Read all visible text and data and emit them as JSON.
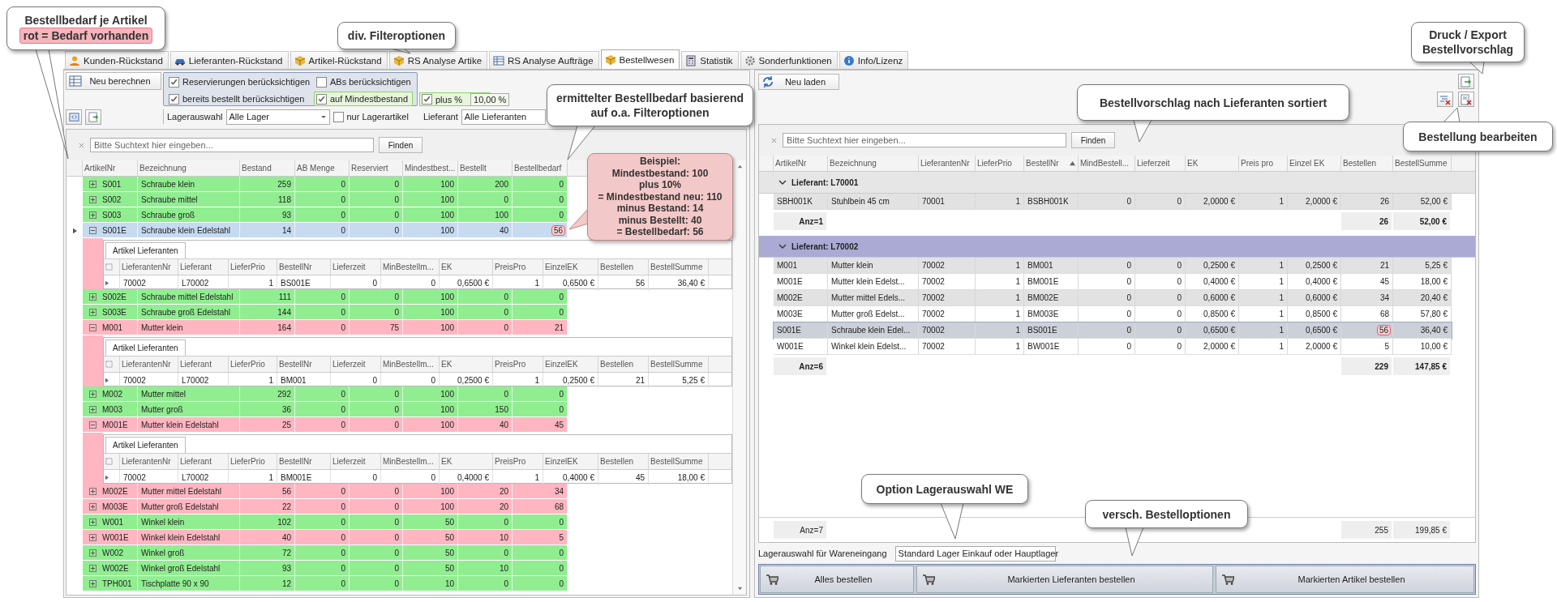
{
  "tabs": [
    {
      "label": "Kunden-Rückstand",
      "selected": false
    },
    {
      "label": "Lieferanten-Rückstand",
      "selected": false
    },
    {
      "label": "Artikel-Rückstand",
      "selected": false
    },
    {
      "label": "RS Analyse Artike",
      "selected": false
    },
    {
      "label": "RS Analyse Aufträge",
      "selected": false
    },
    {
      "label": "Bestellwesen",
      "selected": true
    },
    {
      "label": "Statistik",
      "selected": false
    },
    {
      "label": "Sonderfunktionen",
      "selected": false
    },
    {
      "label": "Info/Lizenz",
      "selected": false
    }
  ],
  "left": {
    "recalc_button": "Neu berechnen",
    "filters": [
      {
        "label": "Reservierungen berücksichtigen",
        "checked": true,
        "highlighted": false
      },
      {
        "label": "ABs berücksichtigen",
        "checked": false,
        "highlighted": false
      },
      {
        "label": "bereits bestellt berücksichtigen",
        "checked": true,
        "highlighted": false
      },
      {
        "label": "auf Mindestbestand",
        "checked": true,
        "highlighted": true
      }
    ],
    "plus_percent": {
      "label": "plus %",
      "checked": true,
      "value": "10,00 %",
      "highlighted": true
    },
    "storage_label": "Lagerauswahl",
    "storage_value": "Alle Lager",
    "stock_only": {
      "label": "nur Lagerartikel",
      "checked": false
    },
    "supplier_label": "Lieferant",
    "supplier_value": "Alle Lieferanten",
    "search": {
      "placeholder": "Bitte Suchtext hier eingeben...",
      "button": "Finden"
    },
    "columns": [
      "ArtikelNr",
      "Bezeichnung",
      "Bestand",
      "AB Menge",
      "Reserviert",
      "Mindestbest...",
      "Bestellt",
      "Bestellbedarf"
    ],
    "rows": [
      {
        "cells": [
          "S001",
          "Schraube klein",
          "259",
          "0",
          "0",
          "100",
          "200",
          "0"
        ],
        "demand": false,
        "selected": false,
        "expanded": false,
        "marked": false
      },
      {
        "cells": [
          "S002",
          "Schraube mittel",
          "118",
          "0",
          "0",
          "100",
          "0",
          "0"
        ],
        "demand": false,
        "selected": false,
        "expanded": false,
        "marked": false
      },
      {
        "cells": [
          "S003",
          "Schraube groß",
          "93",
          "0",
          "0",
          "100",
          "100",
          "0"
        ],
        "demand": false,
        "selected": false,
        "expanded": false,
        "marked": false
      },
      {
        "cells": [
          "S001E",
          "Schraube klein Edelstahl",
          "14",
          "0",
          "0",
          "100",
          "40",
          "56"
        ],
        "demand": true,
        "selected": true,
        "expanded": true,
        "marked": true,
        "detail": {
          "tab": "Artikel Lieferanten",
          "columns": [
            "LieferantenNr",
            "Lieferant",
            "LieferPrio",
            "BestellNr",
            "Lieferzeit",
            "MinBestellm...",
            "EK",
            "PreisPro",
            "EinzelEK",
            "Bestellen",
            "BestellSumme"
          ],
          "rows": [
            [
              "70002",
              "L70002",
              "1",
              "BS001E",
              "0",
              "0",
              "0,6500 €",
              "1",
              "0,6500 €",
              "56",
              "36,40 €"
            ]
          ]
        }
      },
      {
        "cells": [
          "S002E",
          "Schraube mittel Edelstahl",
          "111",
          "0",
          "0",
          "100",
          "0",
          "0"
        ],
        "demand": false,
        "selected": false,
        "expanded": false,
        "marked": false
      },
      {
        "cells": [
          "S003E",
          "Schraube groß Edelstahl",
          "144",
          "0",
          "0",
          "100",
          "0",
          "0"
        ],
        "demand": false,
        "selected": false,
        "expanded": false,
        "marked": false
      },
      {
        "cells": [
          "M001",
          "Mutter klein",
          "164",
          "0",
          "75",
          "100",
          "0",
          "21"
        ],
        "demand": true,
        "selected": false,
        "expanded": true,
        "marked": false,
        "detail": {
          "tab": "Artikel Lieferanten",
          "columns": [
            "LieferantenNr",
            "Lieferant",
            "LieferPrio",
            "BestellNr",
            "Lieferzeit",
            "MinBestellm...",
            "EK",
            "PreisPro",
            "EinzelEK",
            "Bestellen",
            "BestellSumme"
          ],
          "rows": [
            [
              "70002",
              "L70002",
              "1",
              "BM001",
              "0",
              "0",
              "0,2500 €",
              "1",
              "0,2500 €",
              "21",
              "5,25 €"
            ]
          ]
        }
      },
      {
        "cells": [
          "M002",
          "Mutter mittel",
          "292",
          "0",
          "0",
          "100",
          "0",
          "0"
        ],
        "demand": false,
        "selected": false,
        "expanded": false,
        "marked": false
      },
      {
        "cells": [
          "M003",
          "Mutter groß",
          "36",
          "0",
          "0",
          "100",
          "150",
          "0"
        ],
        "demand": false,
        "selected": false,
        "expanded": false,
        "marked": false
      },
      {
        "cells": [
          "M001E",
          "Mutter klein Edelstahl",
          "25",
          "0",
          "0",
          "100",
          "40",
          "45"
        ],
        "demand": true,
        "selected": false,
        "expanded": true,
        "marked": false,
        "detail": {
          "tab": "Artikel Lieferanten",
          "columns": [
            "LieferantenNr",
            "Lieferant",
            "LieferPrio",
            "BestellNr",
            "Lieferzeit",
            "MinBestellm...",
            "EK",
            "PreisPro",
            "EinzelEK",
            "Bestellen",
            "BestellSumme"
          ],
          "rows": [
            [
              "70002",
              "L70002",
              "1",
              "BM001E",
              "0",
              "0",
              "0,4000 €",
              "1",
              "0,4000 €",
              "45",
              "18,00 €"
            ]
          ]
        }
      },
      {
        "cells": [
          "M002E",
          "Mutter mittel Edelstahl",
          "56",
          "0",
          "0",
          "100",
          "20",
          "34"
        ],
        "demand": true,
        "selected": false,
        "expanded": false,
        "marked": false
      },
      {
        "cells": [
          "M003E",
          "Mutter groß Edelstahl",
          "22",
          "0",
          "0",
          "100",
          "20",
          "68"
        ],
        "demand": true,
        "selected": false,
        "expanded": false,
        "marked": false
      },
      {
        "cells": [
          "W001",
          "Winkel klein",
          "102",
          "0",
          "0",
          "50",
          "0",
          "0"
        ],
        "demand": false,
        "selected": false,
        "expanded": false,
        "marked": false
      },
      {
        "cells": [
          "W001E",
          "Winkel klein Edelstahl",
          "40",
          "0",
          "0",
          "50",
          "10",
          "5"
        ],
        "demand": true,
        "selected": false,
        "expanded": false,
        "marked": false
      },
      {
        "cells": [
          "W002",
          "Winkel groß",
          "72",
          "0",
          "0",
          "50",
          "0",
          "0"
        ],
        "demand": false,
        "selected": false,
        "expanded": false,
        "marked": false
      },
      {
        "cells": [
          "W002E",
          "Winkel groß Edelstahl",
          "93",
          "0",
          "0",
          "50",
          "10",
          "0"
        ],
        "demand": false,
        "selected": false,
        "expanded": false,
        "marked": false
      },
      {
        "cells": [
          "TPH001",
          "Tischplatte 90 x 90",
          "12",
          "0",
          "0",
          "10",
          "0",
          "0"
        ],
        "demand": false,
        "selected": false,
        "expanded": false,
        "marked": false
      }
    ]
  },
  "right": {
    "reload_button": "Neu laden",
    "search": {
      "placeholder": "Bitte Suchtext hier eingeben...",
      "button": "Finden"
    },
    "columns": [
      {
        "label": "ArtikelNr",
        "sorted": false
      },
      {
        "label": "Bezeichnung",
        "sorted": false
      },
      {
        "label": "LieferantenNr",
        "sorted": false
      },
      {
        "label": "LieferPrio",
        "sorted": false
      },
      {
        "label": "BestellNr",
        "sorted": true
      },
      {
        "label": "MindBestell...",
        "sorted": false
      },
      {
        "label": "Lieferzeit",
        "sorted": false
      },
      {
        "label": "EK",
        "sorted": false
      },
      {
        "label": "Preis pro",
        "sorted": false
      },
      {
        "label": "Einzel EK",
        "sorted": false
      },
      {
        "label": "Bestellen",
        "sorted": false
      },
      {
        "label": "BestellSumme",
        "sorted": false
      }
    ],
    "groups": [
      {
        "title": "Lieferant: L70001",
        "selected": false,
        "rows": [
          {
            "cells": [
              "SBH001K",
              "Stuhlbein 45 cm",
              "70001",
              "1",
              "BSBH001K",
              "0",
              "0",
              "2,0000 €",
              "1",
              "2,0000 €",
              "26",
              "52,00 €"
            ],
            "selected": false,
            "marked": false
          }
        ],
        "footer": {
          "count": "Anz=1",
          "quantity": "26",
          "sum": "52,00 €"
        }
      },
      {
        "title": "Lieferant: L70002",
        "selected": true,
        "rows": [
          {
            "cells": [
              "M001",
              "Mutter klein",
              "70002",
              "1",
              "BM001",
              "0",
              "0",
              "0,2500 €",
              "1",
              "0,2500 €",
              "21",
              "5,25 €"
            ],
            "selected": false,
            "marked": false
          },
          {
            "cells": [
              "M001E",
              "Mutter klein Edelst...",
              "70002",
              "1",
              "BM001E",
              "0",
              "0",
              "0,4000 €",
              "1",
              "0,4000 €",
              "45",
              "18,00 €"
            ],
            "selected": false,
            "marked": false
          },
          {
            "cells": [
              "M002E",
              "Mutter mittel Edels...",
              "70002",
              "1",
              "BM002E",
              "0",
              "0",
              "0,6000 €",
              "1",
              "0,6000 €",
              "34",
              "20,40 €"
            ],
            "selected": false,
            "marked": false
          },
          {
            "cells": [
              "M003E",
              "Mutter groß Edelst...",
              "70002",
              "1",
              "BM003E",
              "0",
              "0",
              "0,8500 €",
              "1",
              "0,8500 €",
              "68",
              "57,80 €"
            ],
            "selected": false,
            "marked": false
          },
          {
            "cells": [
              "S001E",
              "Schraube klein Edel...",
              "70002",
              "1",
              "BS001E",
              "0",
              "0",
              "0,6500 €",
              "1",
              "0,6500 €",
              "56",
              "36,40 €"
            ],
            "selected": true,
            "marked": true
          },
          {
            "cells": [
              "W001E",
              "Winkel klein Edelst...",
              "70002",
              "1",
              "BW001E",
              "0",
              "0",
              "2,0000 €",
              "1",
              "2,0000 €",
              "5",
              "10,00 €"
            ],
            "selected": false,
            "marked": false
          }
        ],
        "footer": {
          "count": "Anz=6",
          "quantity": "229",
          "sum": "147,85 €"
        }
      }
    ],
    "total": {
      "count": "Anz=7",
      "quantity": "255",
      "sum": "199,85 €"
    },
    "warehouse_label": "Lagerauswahl für Wareneingang",
    "warehouse_value": "Standard Lager Einkauf oder Hauptlager",
    "order_buttons": [
      "Alles bestellen",
      "Markierten Lieferanten bestellen",
      "Markierten Artikel bestellen"
    ]
  },
  "callouts": [
    {
      "kind": "bubble",
      "lines": [
        {
          "text": "Bestellbedarf je Artikel",
          "highlighted": false
        },
        {
          "text": "rot = Bedarf vorhanden",
          "highlighted": true
        }
      ]
    },
    {
      "kind": "bubble",
      "lines": [
        {
          "text": "div. Filteroptionen",
          "highlighted": false
        }
      ]
    },
    {
      "kind": "bubble",
      "lines": [
        {
          "text": "ermittelter Bestellbedarf basierend",
          "highlighted": false
        },
        {
          "text": "auf o.a. Filteroptionen",
          "highlighted": false
        }
      ]
    },
    {
      "kind": "note",
      "lines": [
        {
          "text": "Beispiel:",
          "highlighted": false
        },
        {
          "text": "Mindestbestand: 100",
          "highlighted": false
        },
        {
          "text": "plus 10%",
          "highlighted": false
        },
        {
          "text": "= Mindestbestand neu: 110",
          "highlighted": false
        },
        {
          "text": "minus Bestand: 14",
          "highlighted": false
        },
        {
          "text": "minus Bestellt: 40",
          "highlighted": false
        },
        {
          "text": "= Bestellbedarf: 56",
          "highlighted": false
        }
      ]
    },
    {
      "kind": "bubble",
      "lines": [
        {
          "text": "Druck / Export",
          "highlighted": false
        },
        {
          "text": "Bestellvorschlag",
          "highlighted": false
        }
      ]
    },
    {
      "kind": "bubble",
      "lines": [
        {
          "text": "Bestellvorschlag nach Lieferanten sortiert",
          "highlighted": false
        }
      ]
    },
    {
      "kind": "bubble",
      "lines": [
        {
          "text": "Bestellung bearbeiten",
          "highlighted": false
        }
      ]
    },
    {
      "kind": "bubble",
      "lines": [
        {
          "text": "Option Lagerauswahl WE",
          "highlighted": false
        }
      ]
    },
    {
      "kind": "bubble",
      "lines": [
        {
          "text": "versch. Bestelloptionen",
          "highlighted": false
        }
      ]
    }
  ]
}
